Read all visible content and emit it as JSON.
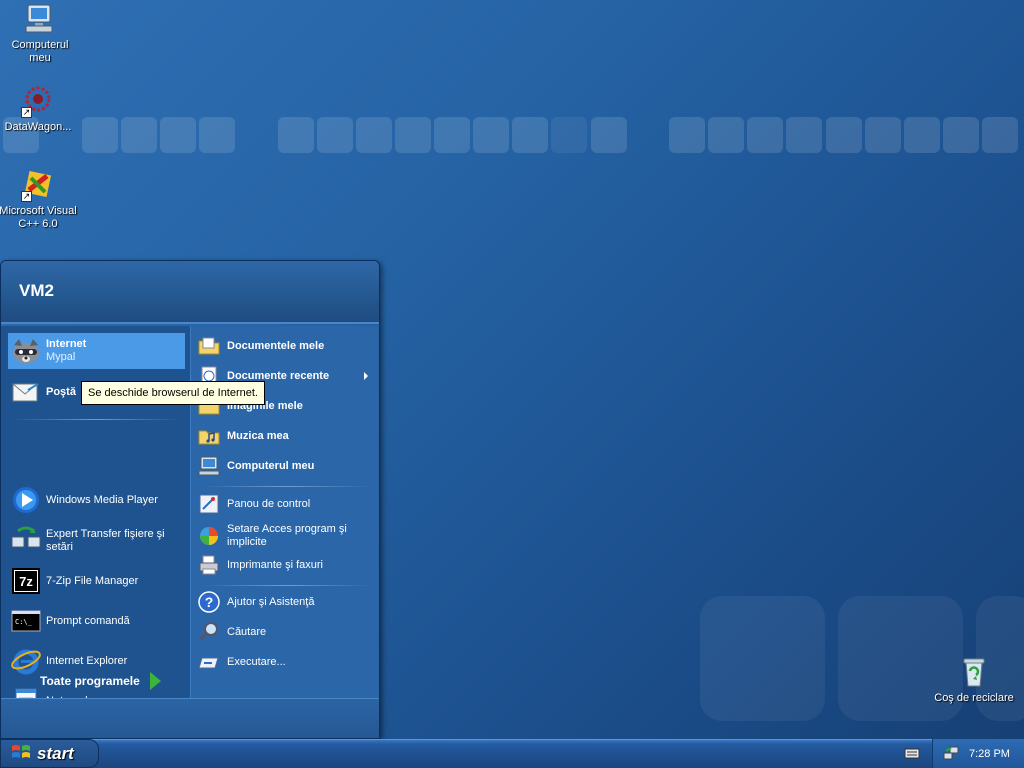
{
  "desktop": {
    "icons": [
      {
        "label": "Computerul meu",
        "icon": "computer-icon"
      },
      {
        "label": "DataWagon...",
        "icon": "datawagon-icon"
      },
      {
        "label": "Microsoft Visual C++ 6.0",
        "icon": "visual-cpp-icon"
      },
      {
        "label": "Coş de reciclare",
        "icon": "recycle-bin-icon"
      }
    ]
  },
  "start_menu": {
    "user": "VM2",
    "left": {
      "pinned": [
        {
          "title": "Internet",
          "subtitle": "Mypal",
          "icon": "raccoon-browser-icon"
        },
        {
          "title": "Poştă",
          "icon": "mail-icon"
        }
      ],
      "recent": [
        {
          "label": "Windows Media Player",
          "icon": "media-player-icon"
        },
        {
          "label": "Expert Transfer fişiere şi setări",
          "icon": "transfer-wizard-icon"
        },
        {
          "label": "7-Zip File Manager",
          "icon": "7zip-icon"
        },
        {
          "label": "Prompt comandă",
          "icon": "command-prompt-icon"
        },
        {
          "label": "Internet Explorer",
          "icon": "internet-explorer-icon"
        },
        {
          "label": "Notepad",
          "icon": "notepad-icon"
        }
      ],
      "all_programs": "Toate programele"
    },
    "right": {
      "places": [
        {
          "label": "Documentele mele",
          "icon": "documents-folder-icon"
        },
        {
          "label": "Documente recente",
          "icon": "recent-documents-icon"
        },
        {
          "label": "Imaginile mele",
          "icon": "pictures-folder-icon"
        },
        {
          "label": "Muzica mea",
          "icon": "music-folder-icon"
        },
        {
          "label": "Computerul meu",
          "icon": "my-computer-icon"
        }
      ],
      "settings": [
        {
          "label": "Panou de control",
          "icon": "control-panel-icon"
        },
        {
          "label": "Setare Acces program şi implicite",
          "icon": "program-access-icon"
        },
        {
          "label": "Imprimante şi faxuri",
          "icon": "printer-icon"
        }
      ],
      "help": [
        {
          "label": "Ajutor şi Asistenţă",
          "icon": "help-icon"
        },
        {
          "label": "Căutare",
          "icon": "search-icon"
        },
        {
          "label": "Executare...",
          "icon": "run-icon"
        }
      ]
    },
    "tooltip": "Se deschide browserul de Internet."
  },
  "taskbar": {
    "start_label": "start",
    "clock": "7:28 PM"
  }
}
